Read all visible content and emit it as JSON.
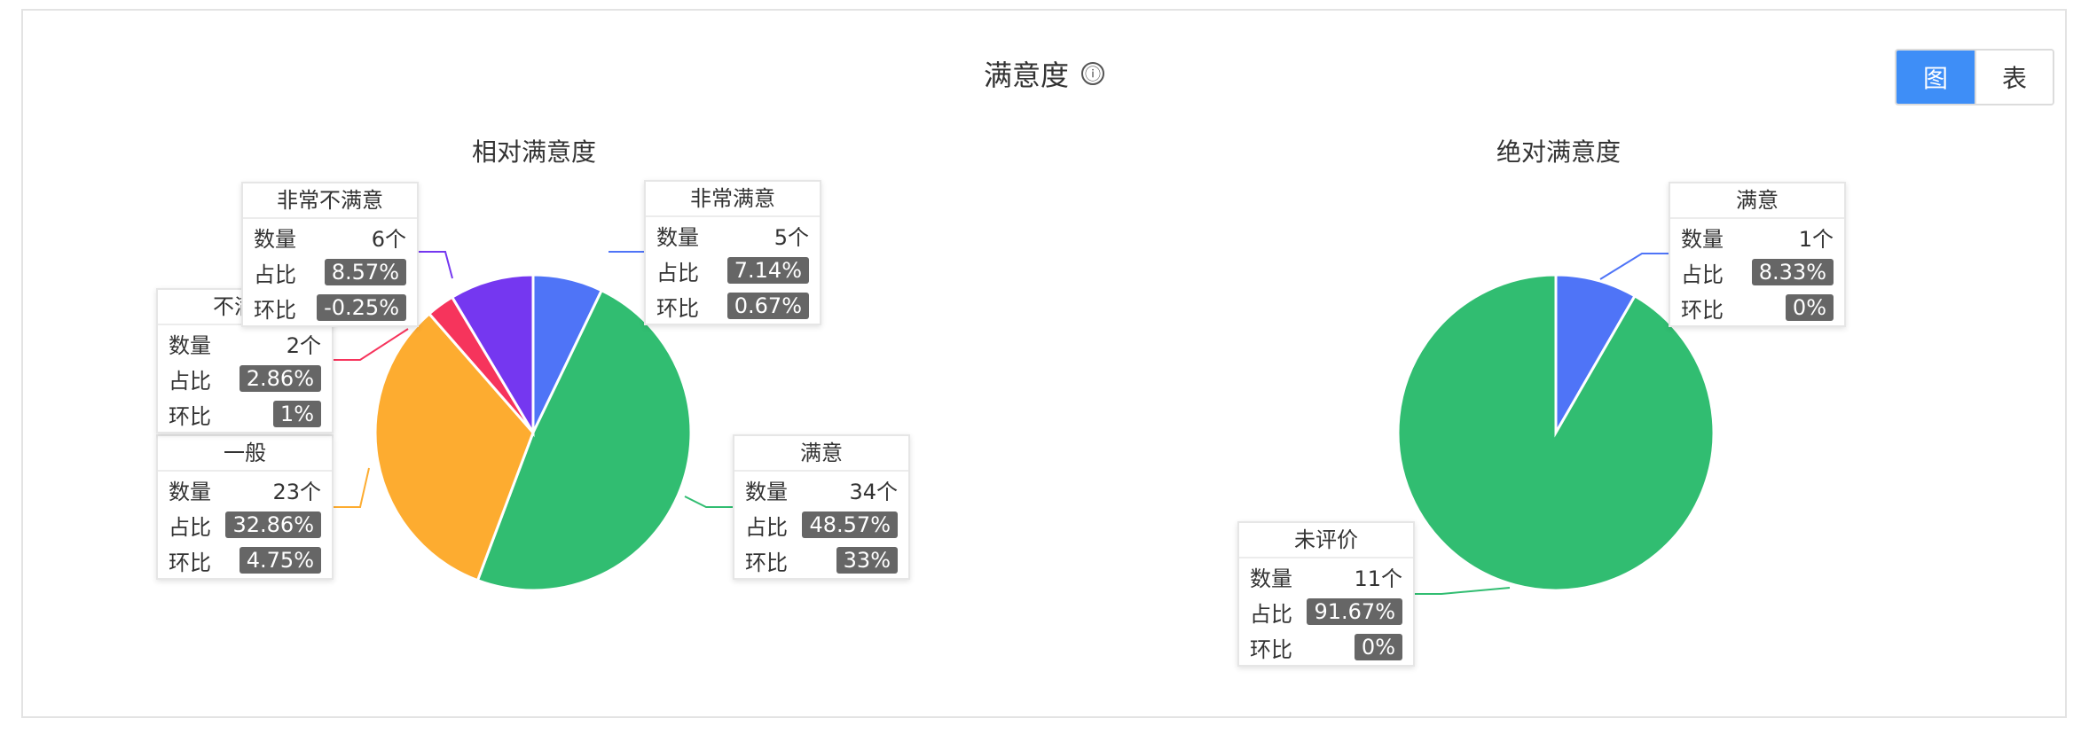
{
  "header": {
    "title": "满意度",
    "info_icon": "ⓘ",
    "toggle": [
      {
        "label": "图",
        "active": true
      },
      {
        "label": "表",
        "active": false
      }
    ]
  },
  "labels": {
    "count": "数量",
    "ratio": "占比",
    "mom": "环比"
  },
  "chart_data": [
    {
      "type": "pie",
      "title": "相对满意度",
      "slices": [
        {
          "name": "非常满意",
          "value": 5,
          "count": "5个",
          "ratio": "7.14%",
          "mom": "0.67%",
          "color": "#4f74f7"
        },
        {
          "name": "满意",
          "value": 34,
          "count": "34个",
          "ratio": "48.57%",
          "mom": "33%",
          "color": "#31bd71"
        },
        {
          "name": "一般",
          "value": 23,
          "count": "23个",
          "ratio": "32.86%",
          "mom": "4.75%",
          "color": "#fdac30"
        },
        {
          "name": "不满意",
          "value": 2,
          "count": "2个",
          "ratio": "2.86%",
          "mom": "1%",
          "color": "#f6345c"
        },
        {
          "name": "非常不满意",
          "value": 6,
          "count": "6个",
          "ratio": "8.57%",
          "mom": "-0.25%",
          "color": "#7537f0"
        }
      ]
    },
    {
      "type": "pie",
      "title": "绝对满意度",
      "slices": [
        {
          "name": "满意",
          "value": 1,
          "count": "1个",
          "ratio": "8.33%",
          "mom": "0%",
          "color": "#4f74f7"
        },
        {
          "name": "未评价",
          "value": 11,
          "count": "11个",
          "ratio": "91.67%",
          "mom": "0%",
          "color": "#31bd71"
        }
      ]
    }
  ]
}
